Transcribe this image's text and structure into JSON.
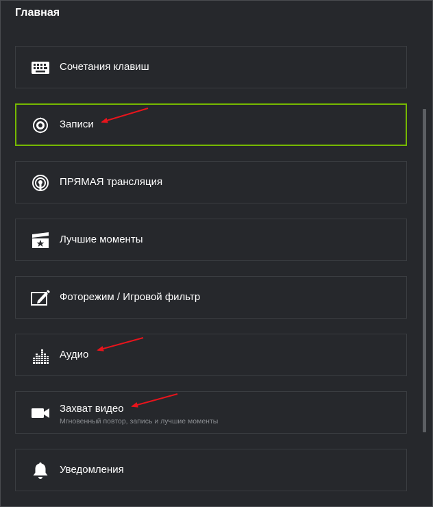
{
  "header": {
    "title": "Главная"
  },
  "menu": {
    "items": [
      {
        "label": "Сочетания клавиш",
        "icon": "keyboard-icon"
      },
      {
        "label": "Записи",
        "icon": "record-icon"
      },
      {
        "label": "ПРЯМАЯ трансляция",
        "icon": "broadcast-icon"
      },
      {
        "label": "Лучшие моменты",
        "icon": "clapperboard-star-icon"
      },
      {
        "label": "Фоторежим / Игровой фильтр",
        "icon": "photo-edit-icon"
      },
      {
        "label": "Аудио",
        "icon": "audio-equalizer-icon"
      },
      {
        "label": "Захват видео",
        "sublabel": "Мгновенный повтор, запись и лучшие моменты",
        "icon": "video-camera-icon"
      },
      {
        "label": "Уведомления",
        "icon": "bell-icon"
      }
    ]
  },
  "colors": {
    "accent": "#76b900",
    "arrow": "#e8141c",
    "background": "#26282c",
    "border": "#3a3d41"
  }
}
